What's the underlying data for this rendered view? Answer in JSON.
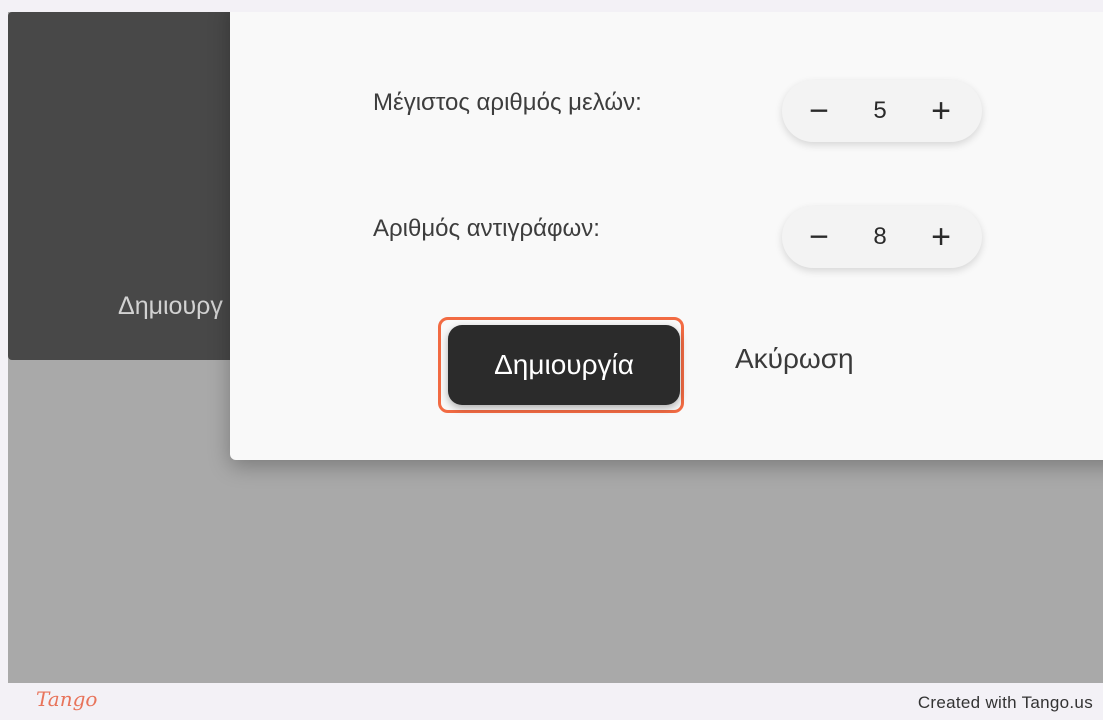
{
  "background": {
    "card_label": "Δημιουργ"
  },
  "dialog": {
    "fields": [
      {
        "label": "Μέγιστος αριθμός μελών:",
        "decrement": "−",
        "value": "5",
        "increment": "+"
      },
      {
        "label": "Αριθμός αντιγράφων:",
        "decrement": "−",
        "value": "8",
        "increment": "+"
      }
    ],
    "create_label": "Δημιουργία",
    "cancel_label": "Ακύρωση"
  },
  "footer": {
    "logo": "Tango",
    "credit": "Created with Tango.us"
  },
  "colors": {
    "highlight": "#f26b43",
    "primary_button": "#2b2b2b",
    "logo": "#e8745b"
  }
}
